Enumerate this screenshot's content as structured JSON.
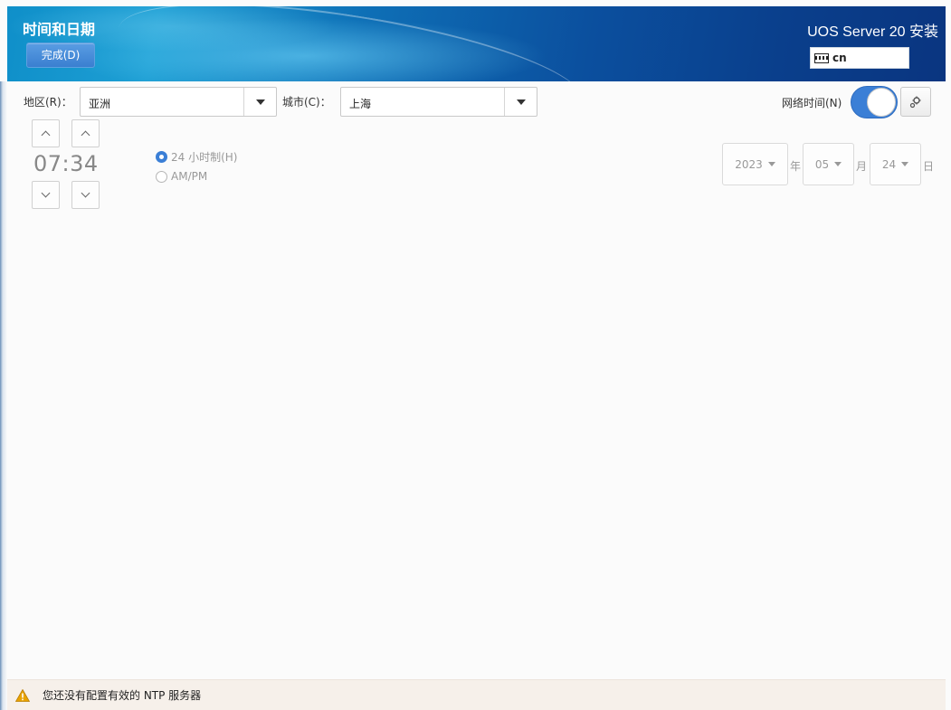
{
  "header": {
    "title": "时间和日期",
    "done_label": "完成(D)",
    "product_title": "UOS Server 20 安装",
    "keyboard_layout": "cn"
  },
  "region": {
    "label": "地区(R)：",
    "value": "亚洲"
  },
  "city": {
    "label": "城市(C)：",
    "value": "上海"
  },
  "ntp": {
    "label": "网络时间(N)",
    "enabled": true
  },
  "time": {
    "display": "07:34",
    "format_24h_label": "24 小时制(H)",
    "format_ampm_label": "AM/PM",
    "selected_format": "24h"
  },
  "date": {
    "year": "2023",
    "year_unit": "年",
    "month": "05",
    "month_unit": "月",
    "day": "24",
    "day_unit": "日"
  },
  "status": {
    "message": "您还没有配置有效的 NTP 服务器"
  },
  "colors": {
    "accent": "#3b7fd6",
    "warning": "#e8a200",
    "status_bg": "#f6f0ea"
  },
  "icons": {
    "keyboard": "keyboard-icon",
    "gear": "gear-icon",
    "warning": "warning-icon",
    "dropdown": "caret-down-icon"
  }
}
